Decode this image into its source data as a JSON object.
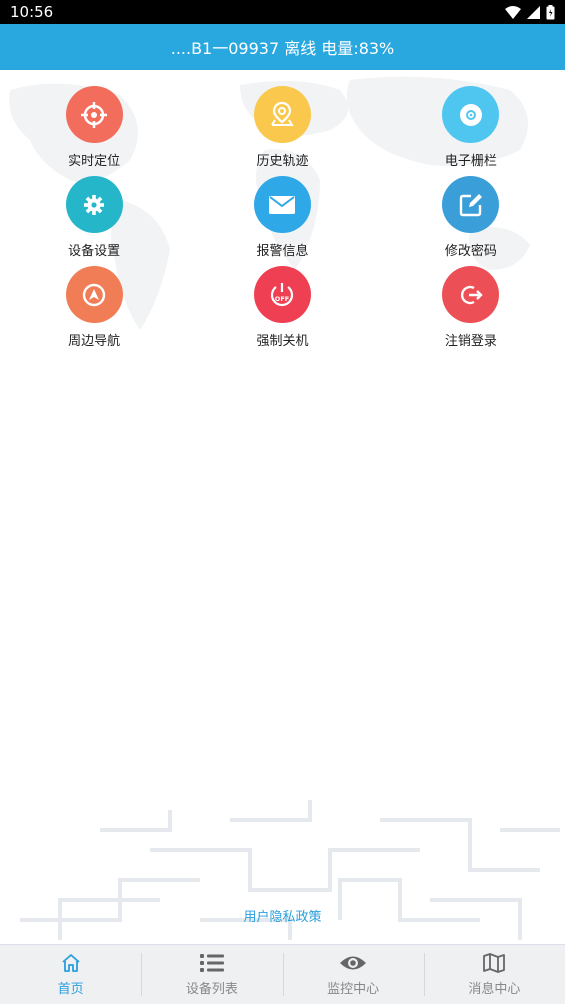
{
  "status_bar": {
    "time": "10:56"
  },
  "header": {
    "title": "....B1一09937 离线 电量:83%"
  },
  "menu": [
    {
      "label": "实时定位",
      "icon": "crosshair-icon",
      "color": "#f26d5b"
    },
    {
      "label": "历史轨迹",
      "icon": "location-pin-icon",
      "color": "#f9c84d"
    },
    {
      "label": "电子栅栏",
      "icon": "disc-icon",
      "color": "#4fc6f0"
    },
    {
      "label": "设备设置",
      "icon": "gear-icon",
      "color": "#25b6c9"
    },
    {
      "label": "报警信息",
      "icon": "envelope-icon",
      "color": "#2fa8e8"
    },
    {
      "label": "修改密码",
      "icon": "edit-icon",
      "color": "#3a9fd9"
    },
    {
      "label": "周边导航",
      "icon": "navigation-icon",
      "color": "#f07d55"
    },
    {
      "label": "强制关机",
      "icon": "power-off-icon",
      "color": "#ef3f52"
    },
    {
      "label": "注销登录",
      "icon": "logout-icon",
      "color": "#ec4f55"
    }
  ],
  "footer": {
    "privacy_link": "用户隐私政策"
  },
  "tabs": [
    {
      "label": "首页",
      "icon": "home-icon",
      "active": true
    },
    {
      "label": "设备列表",
      "icon": "list-icon",
      "active": false
    },
    {
      "label": "监控中心",
      "icon": "eye-icon",
      "active": false
    },
    {
      "label": "消息中心",
      "icon": "map-icon",
      "active": false
    }
  ]
}
